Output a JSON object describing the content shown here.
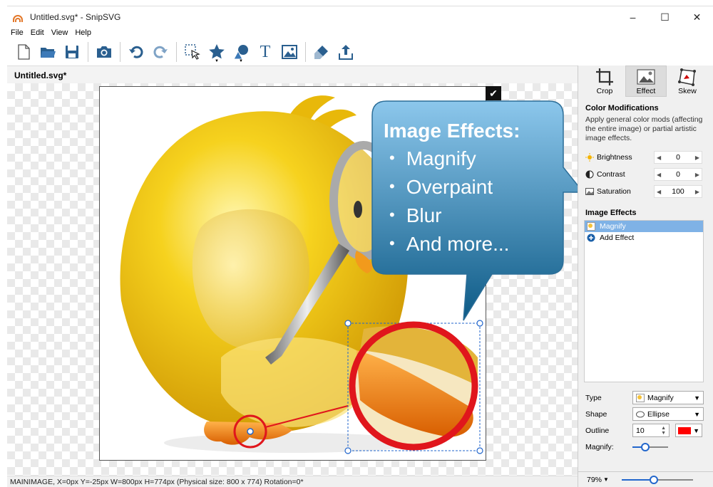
{
  "window": {
    "title": "Untitled.svg* - SnipSVG",
    "minimize_glyph": "–",
    "maximize_glyph": "☐",
    "close_glyph": "✕"
  },
  "menu": [
    "File",
    "Edit",
    "View",
    "Help"
  ],
  "toolbar": {
    "icons": [
      "new-file-icon",
      "open-folder-icon",
      "save-icon",
      "camera-icon",
      "undo-icon",
      "redo-icon",
      "select-icon",
      "star-shape-icon",
      "shapes-icon",
      "text-icon",
      "image-icon",
      "fill-icon",
      "export-icon"
    ],
    "text_tool": "T",
    "drop_glyph": "▼"
  },
  "document": {
    "tab": "Untitled.svg*",
    "check_glyph": "✔"
  },
  "callout": {
    "title": "Image Effects:",
    "items": [
      "Magnify",
      "Overpaint",
      "Blur",
      "And more..."
    ]
  },
  "status": "MAINIMAGE, X=0px  Y=-25px  W=800px  H=774px (Physical size: 800 x 774)  Rotation=0*",
  "panel": {
    "tabs": [
      {
        "label": "Crop",
        "icon": "crop-icon"
      },
      {
        "label": "Effect",
        "icon": "effect-icon"
      },
      {
        "label": "Skew",
        "icon": "skew-icon"
      }
    ],
    "color_mods": {
      "title": "Color Modifications",
      "description": "Apply general color mods (affecting the entire image) or partial artistic image effects.",
      "rows": [
        {
          "label": "Brightness",
          "value": "0",
          "icon": "sun-icon"
        },
        {
          "label": "Contrast",
          "value": "0",
          "icon": "contrast-icon"
        },
        {
          "label": "Saturation",
          "value": "100",
          "icon": "saturation-icon"
        }
      ]
    },
    "image_effects": {
      "title": "Image Effects",
      "items": [
        {
          "label": "Magnify",
          "selected": true
        },
        {
          "label": "Add Effect",
          "selected": false
        }
      ]
    },
    "props": {
      "type_label": "Type",
      "type_value": "Magnify",
      "shape_label": "Shape",
      "shape_value": "Ellipse",
      "outline_label": "Outline",
      "outline_value": "10",
      "outline_color": "#ff0000",
      "magnify_label": "Magnify:",
      "magnify_level": 0.35
    },
    "zoom": {
      "value": "79%",
      "level": 0.45
    }
  },
  "colors": {
    "accent": "#2266cc",
    "callout_top": "#8cc7ec",
    "callout_bottom": "#0d5a86",
    "duck_yellow": "#f2c60d",
    "feet_orange": "#f07d10",
    "magnifier_red": "#e0161c"
  }
}
